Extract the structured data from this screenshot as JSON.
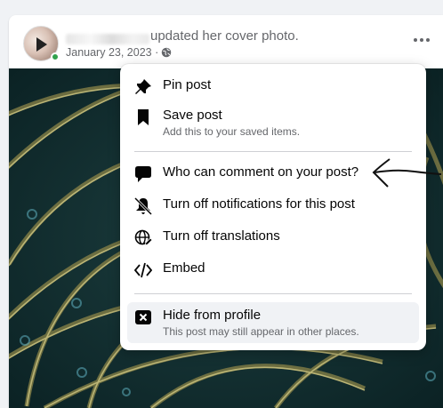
{
  "post": {
    "action_text": "updated her cover photo.",
    "date": "January 23, 2023 ·"
  },
  "menu": {
    "pin_label": "Pin post",
    "save_label": "Save post",
    "save_sub": "Add this to your saved items.",
    "comment_label": "Who can comment on your post?",
    "notif_label": "Turn off notifications for this post",
    "translate_label": "Turn off translations",
    "embed_label": "Embed",
    "hide_label": "Hide from profile",
    "hide_sub": "This post may still appear in other places."
  },
  "colors": {
    "text_primary": "#050505",
    "text_secondary": "#65676b",
    "highlight": "#f0f2f5",
    "online": "#31a24c",
    "image_bg": "#0f2b2d"
  },
  "icons": [
    "pin-icon",
    "bookmark-icon",
    "comment-icon",
    "bell-off-icon",
    "globe-edit-icon",
    "code-icon",
    "close-box-icon",
    "globe-icon",
    "more-icon"
  ]
}
